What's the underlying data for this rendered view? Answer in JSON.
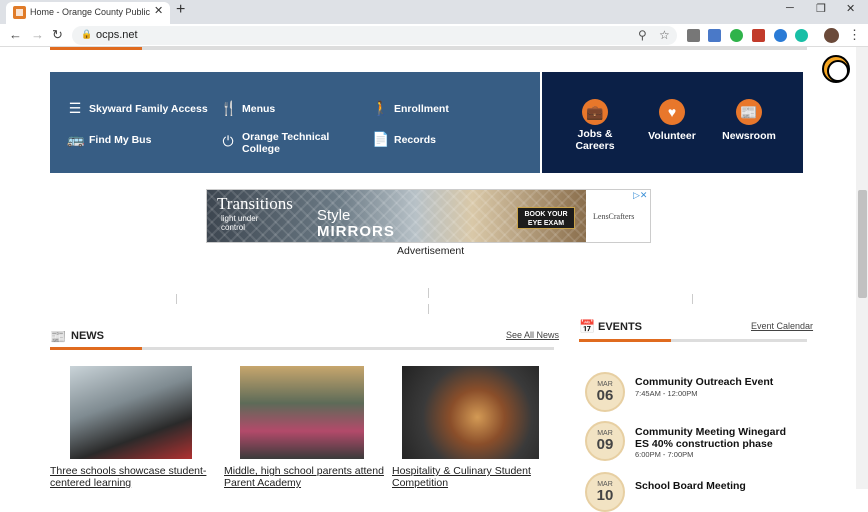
{
  "browser": {
    "tab_title": "Home - Orange County Public Sc",
    "tab_close": "✕",
    "new_tab": "+",
    "url": "ocps.net",
    "window_min": "─",
    "window_restore": "❐",
    "window_close": "✕"
  },
  "colors": {
    "orange": "#e06b1f",
    "quick_links_bg": "#375d84",
    "featured_bg": "#0b2047"
  },
  "quick_links": [
    {
      "label": "Skyward Family Access",
      "icon": "list-icon"
    },
    {
      "label": "Menus",
      "icon": "utensils-icon"
    },
    {
      "label": "Enrollment",
      "icon": "person-icon"
    },
    {
      "label": "Find My Bus",
      "icon": "bus-icon"
    },
    {
      "label": "Orange Technical College",
      "icon": "power-icon"
    },
    {
      "label": "Records",
      "icon": "document-icon"
    }
  ],
  "featured": [
    {
      "label": "Jobs & Careers",
      "icon": "briefcase-icon"
    },
    {
      "label": "Volunteer",
      "icon": "heart-icon"
    },
    {
      "label": "Newsroom",
      "icon": "newspaper-icon"
    }
  ],
  "ad": {
    "brand": "Transitions",
    "tagline": "light under control",
    "headline_1": "Style",
    "headline_2": "MIRRORS",
    "cta": "BOOK YOUR EYE EXAM",
    "partner": "LensCrafters",
    "label": "Advertisement"
  },
  "news": {
    "title": "NEWS",
    "link": "See All News",
    "items": [
      {
        "caption_1": "Three schools showcase student-",
        "caption_2": "centered learning"
      },
      {
        "caption_1": "Middle, high school parents attend",
        "caption_2": "Parent Academy"
      },
      {
        "caption_1": "Hospitality & Culinary Student",
        "caption_2": "Competition"
      }
    ]
  },
  "events": {
    "title": "EVENTS",
    "link": "Event Calendar",
    "items": [
      {
        "month": "MAR",
        "day": "06",
        "title": "Community Outreach Event",
        "time": "7:45AM - 12:00PM"
      },
      {
        "month": "MAR",
        "day": "09",
        "title": "Community Meeting Winegard ES 40% construction phase",
        "time": "6:00PM - 7:00PM"
      },
      {
        "month": "MAR",
        "day": "10",
        "title": "School Board Meeting",
        "time": ""
      }
    ]
  }
}
